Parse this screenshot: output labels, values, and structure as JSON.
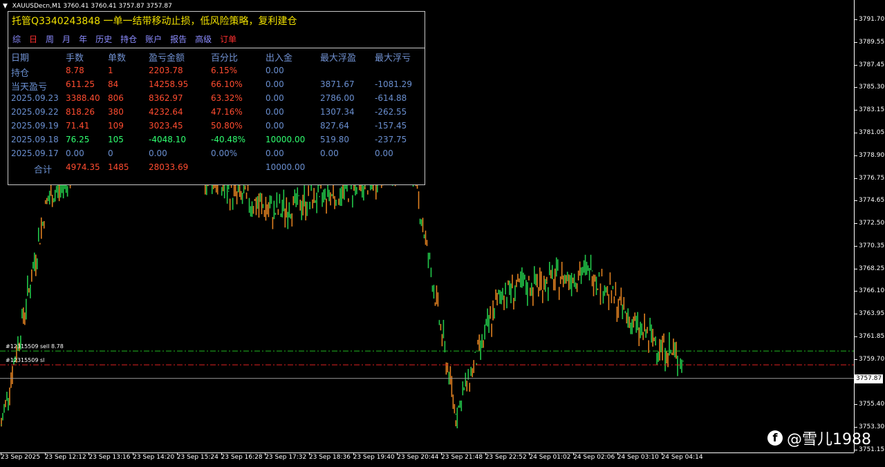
{
  "symbol_header": "XAUUSDecn,M1  3760.41 3760.41 3757.87 3757.87",
  "panel": {
    "title": "托管Q3340243848 一单一结带移动止损，低风险策略，复利建仓",
    "tabs": [
      {
        "label": "综",
        "color": "blue"
      },
      {
        "label": "日",
        "color": "red"
      },
      {
        "label": "周",
        "color": "blue"
      },
      {
        "label": "月",
        "color": "blue"
      },
      {
        "label": "年",
        "color": "blue"
      },
      {
        "label": "历史",
        "color": "blue"
      },
      {
        "label": "持仓",
        "color": "blue"
      },
      {
        "label": "账户",
        "color": "blue"
      },
      {
        "label": "报告",
        "color": "blue"
      },
      {
        "label": "高级",
        "color": "blue"
      },
      {
        "label": "订单",
        "color": "red"
      }
    ],
    "columns": [
      "日期",
      "手数",
      "单数",
      "盈亏金额",
      "百分比",
      "出入金",
      "最大浮盈",
      "最大浮亏"
    ],
    "rows": [
      {
        "date": "持仓",
        "lots": "8.78",
        "orders": "1",
        "pnl": "2203.78",
        "pct": "6.15%",
        "funds": "0.00",
        "max_profit": "",
        "max_loss": "",
        "tone": "red"
      },
      {
        "date": "当天盈亏",
        "lots": "611.25",
        "orders": "84",
        "pnl": "14258.95",
        "pct": "66.10%",
        "funds": "0.00",
        "max_profit": "3871.67",
        "max_loss": "-1081.29",
        "tone": "red"
      },
      {
        "date": "2025.09.23",
        "lots": "3388.40",
        "orders": "806",
        "pnl": "8362.97",
        "pct": "63.32%",
        "funds": "0.00",
        "max_profit": "2786.00",
        "max_loss": "-614.88",
        "tone": "red"
      },
      {
        "date": "2025.09.22",
        "lots": "818.26",
        "orders": "380",
        "pnl": "4232.64",
        "pct": "47.16%",
        "funds": "0.00",
        "max_profit": "1307.34",
        "max_loss": "-262.55",
        "tone": "red"
      },
      {
        "date": "2025.09.19",
        "lots": "71.41",
        "orders": "109",
        "pnl": "3023.45",
        "pct": "50.80%",
        "funds": "0.00",
        "max_profit": "827.64",
        "max_loss": "-157.45",
        "tone": "red"
      },
      {
        "date": "2025.09.18",
        "lots": "76.25",
        "orders": "105",
        "pnl": "-4048.10",
        "pct": "-40.48%",
        "funds": "10000.00",
        "max_profit": "519.80",
        "max_loss": "-237.75",
        "tone": "green"
      },
      {
        "date": "2025.09.17",
        "lots": "0.00",
        "orders": "0",
        "pnl": "0.00",
        "pct": "0.00%",
        "funds": "0.00",
        "max_profit": "0.00",
        "max_loss": "0.00",
        "tone": "blue"
      },
      {
        "date": "合计",
        "lots": "4974.35",
        "orders": "1485",
        "pnl": "28033.69",
        "pct": "",
        "funds": "10000.00",
        "max_profit": "",
        "max_loss": "",
        "tone": "red"
      }
    ]
  },
  "price_axis": [
    "3791.70",
    "3789.55",
    "3787.45",
    "3785.30",
    "3783.15",
    "3781.05",
    "3778.90",
    "3776.75",
    "3774.65",
    "3772.50",
    "3770.35",
    "3768.25",
    "3766.10",
    "3763.95",
    "3761.85",
    "3759.70",
    "3757.87",
    "3755.40",
    "3753.30",
    "3751.15"
  ],
  "current_price": "3757.87",
  "time_axis": [
    "23 Sep 2025",
    "23 Sep 12:12",
    "23 Sep 13:16",
    "23 Sep 14:20",
    "23 Sep 15:24",
    "23 Sep 16:28",
    "23 Sep 17:32",
    "23 Sep 18:36",
    "23 Sep 19:40",
    "23 Sep 20:44",
    "23 Sep 21:48",
    "23 Sep 22:52",
    "24 Sep 01:02",
    "24 Sep 02:06",
    "24 Sep 03:10",
    "24 Sep 04:14"
  ],
  "order_lines": [
    {
      "label": "#12315509 sell 8.78",
      "price": 3760.45,
      "color": "#22b822"
    },
    {
      "label": "#12315509 sl",
      "price": 3759.15,
      "color": "#e02020"
    }
  ],
  "watermark": "@雪儿1988",
  "chart_data": {
    "type": "line",
    "title": "XAUUSDecn,M1",
    "ylim": [
      3751.15,
      3791.7
    ],
    "x": [
      "23 Sep 2025",
      "23 Sep 12:12",
      "23 Sep 13:16",
      "23 Sep 14:20",
      "23 Sep 15:24",
      "23 Sep 16:28",
      "23 Sep 17:32",
      "23 Sep 18:36",
      "23 Sep 19:40",
      "23 Sep 20:44",
      "23 Sep 21:48",
      "23 Sep 22:52",
      "24 Sep 01:02",
      "24 Sep 02:06",
      "24 Sep 03:10",
      "24 Sep 04:14"
    ],
    "series": [
      {
        "values": [
          3753.5,
          3774.5,
          3779.0,
          3781.0,
          3778.5,
          3775.5,
          3773.5,
          3775.0,
          3776.0,
          3779.0,
          3754.5,
          3766.0,
          3767.0,
          3768.0,
          3762.5,
          3759.5
        ]
      }
    ],
    "colors": {
      "up": "#22c84a",
      "down": "#e08020"
    }
  }
}
